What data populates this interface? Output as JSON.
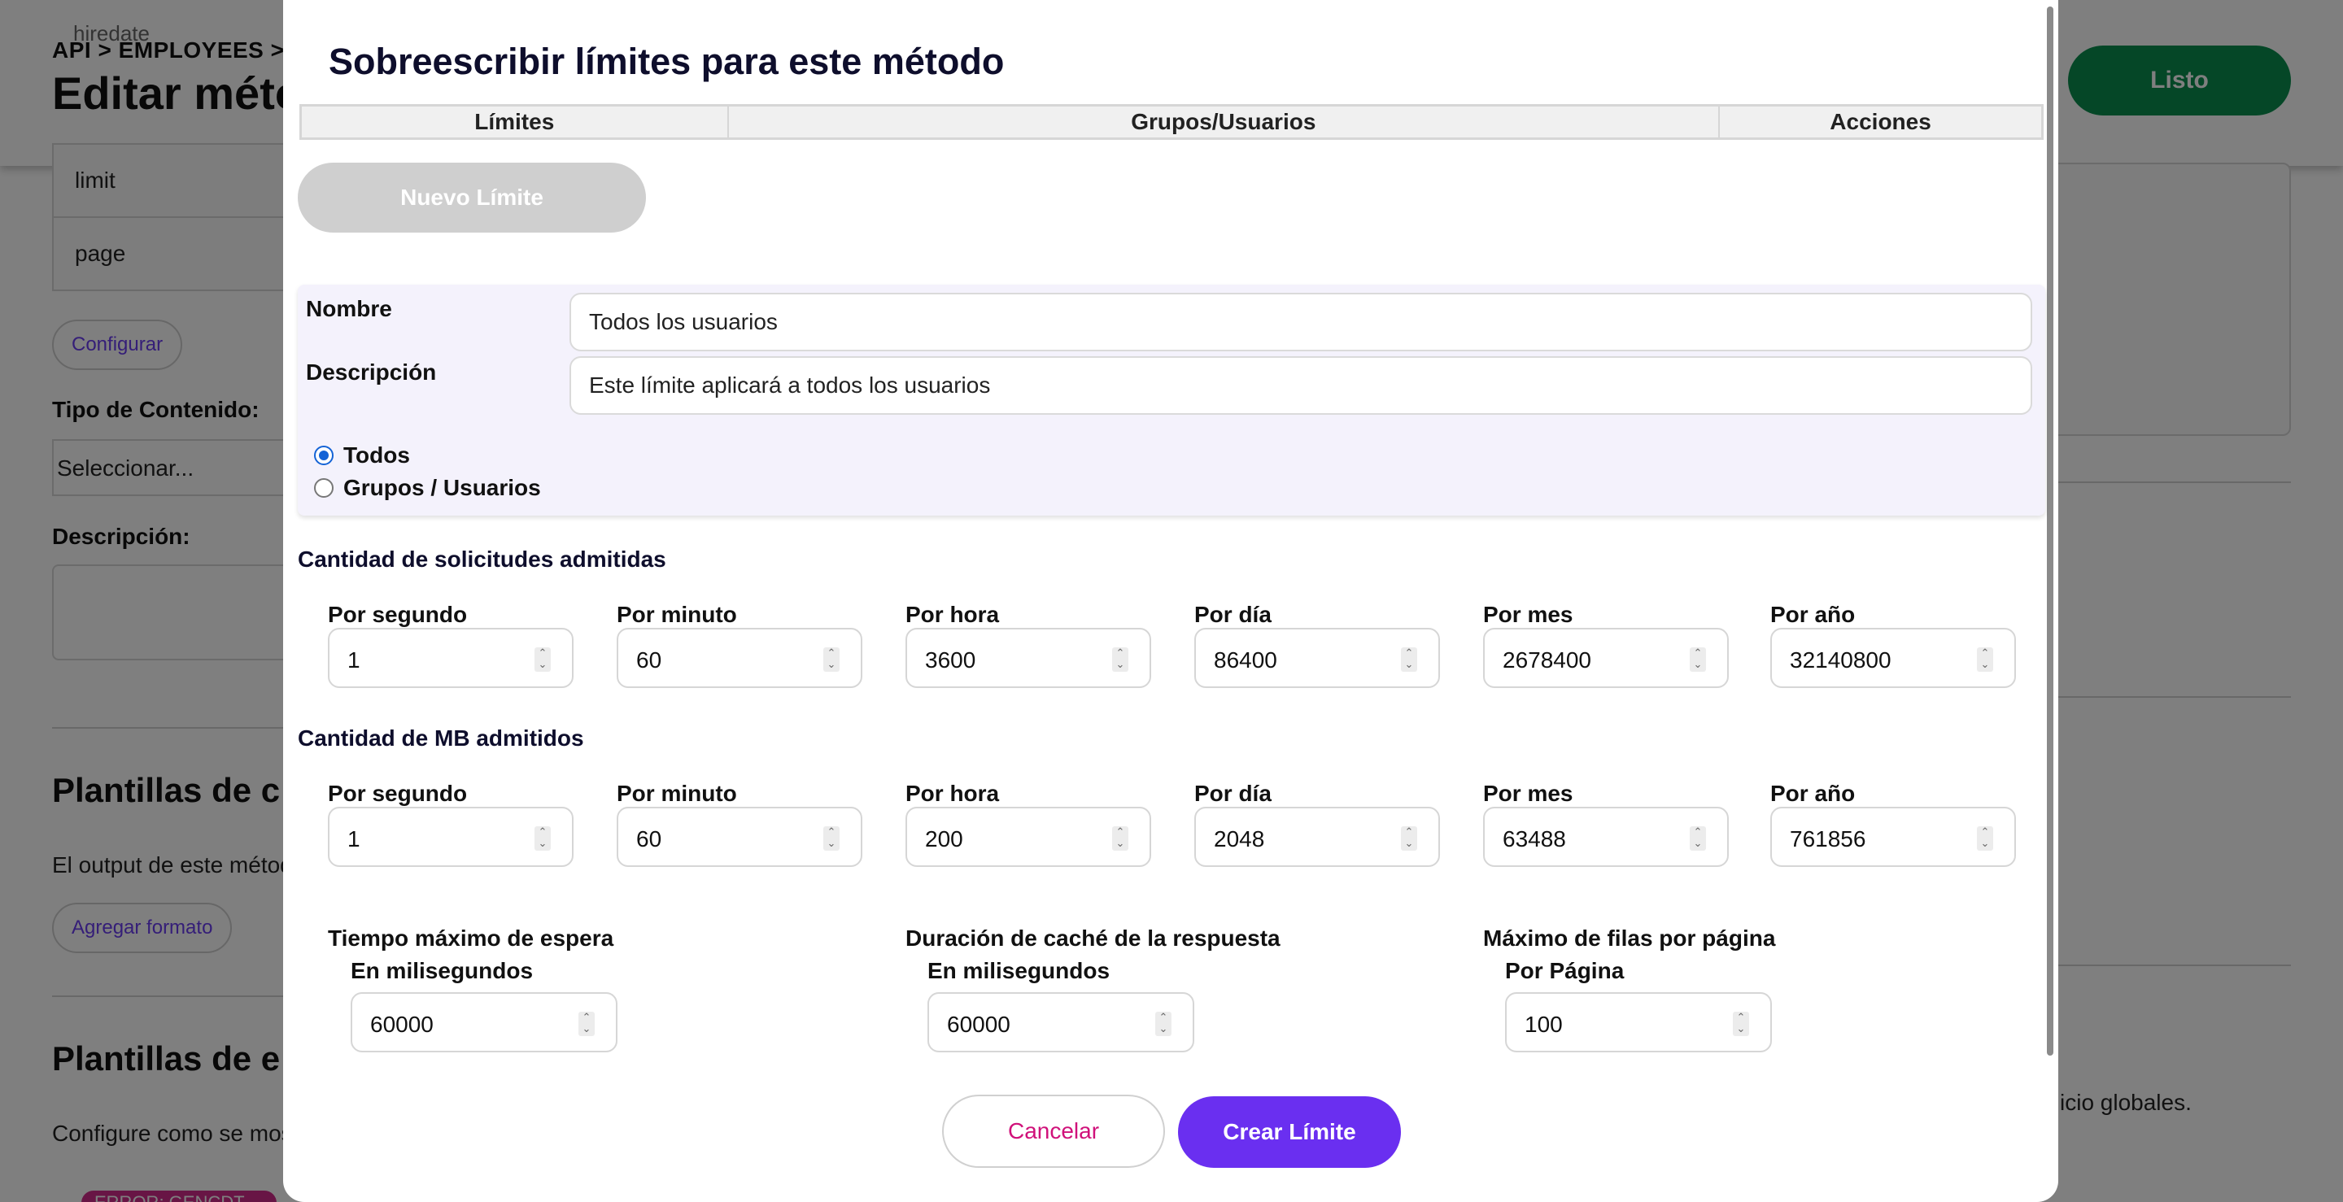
{
  "background": {
    "ghost_field": "hiredate",
    "breadcrumb": "API > EMPLOYEES > VE",
    "page_title": "Editar méto",
    "done_button": "Listo",
    "params": [
      "limit",
      "page"
    ],
    "configure_button": "Configurar",
    "content_type_label": "Tipo de Contenido:",
    "content_type_value": "Seleccionar...",
    "description_label": "Descripción:",
    "output_section_title": "Plantillas de c",
    "output_text": "El output de este método",
    "add_format_button": "Agregar formato",
    "error_section_title": "Plantillas de e",
    "error_text": "Configure como se most",
    "error_text_right": "icio globales.",
    "error_badge": "ERROR: GENCDT-EA"
  },
  "modal": {
    "title": "Sobreescribir límites para este método",
    "table_headers": [
      "Límites",
      "Grupos/Usuarios",
      "Acciones"
    ],
    "new_limit_button": "Nuevo Límite",
    "name_label": "Nombre",
    "name_value": "Todos los usuarios",
    "description_label": "Descripción",
    "description_value": "Este límite aplicará a todos los usuarios",
    "scope_options": [
      "Todos",
      "Grupos / Usuarios"
    ],
    "scope_selected": "Todos",
    "requests_section": "Cantidad de solicitudes admitidas",
    "mb_section": "Cantidad de MB admitidos",
    "period_labels": [
      "Por segundo",
      "Por minuto",
      "Por hora",
      "Por día",
      "Por mes",
      "Por año"
    ],
    "requests_values": [
      "1",
      "60",
      "3600",
      "86400",
      "2678400",
      "32140800"
    ],
    "mb_values": [
      "1",
      "60",
      "200",
      "2048",
      "63488",
      "761856"
    ],
    "timeout_label": "Tiempo máximo de espera",
    "timeout_unit": "En milisegundos",
    "timeout_value": "60000",
    "cache_label": "Duración de caché de la respuesta",
    "cache_unit": "En milisegundos",
    "cache_value": "60000",
    "rows_label": "Máximo de filas por página",
    "rows_unit": "Por Página",
    "rows_value": "100",
    "cancel_button": "Cancelar",
    "create_button": "Crear Límite"
  },
  "colors": {
    "primary": "#6a2ff0",
    "success": "#0b8f4f",
    "cancel_text": "#d0117a",
    "radio_selected": "#1463d6",
    "disabled_button": "#cfcfcf"
  },
  "icons": [
    "chevron-up-icon",
    "chevron-down-icon"
  ]
}
